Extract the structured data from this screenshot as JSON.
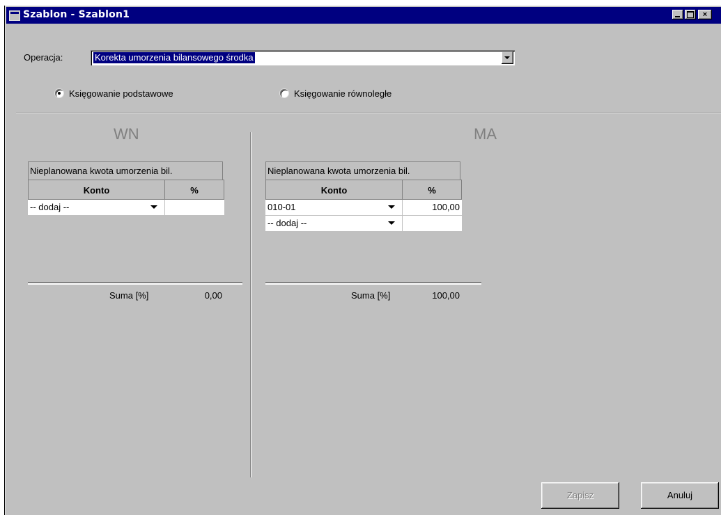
{
  "window": {
    "title": "Szablon - Szablon1",
    "min_label": "",
    "max_label": "",
    "close_label": "×"
  },
  "operation": {
    "label": "Operacja:",
    "value": "Korekta umorzenia bilansowego środka"
  },
  "posting": {
    "basic_label": "Księgowanie podstawowe",
    "parallel_label": "Księgowanie równoległe",
    "selected": "basic"
  },
  "wn": {
    "heading": "WN",
    "caption": "Nieplanowana kwota umorzenia bil.",
    "col_konto": "Konto",
    "col_pct": "%",
    "rows": [
      {
        "konto": "-- dodaj --",
        "pct": ""
      }
    ],
    "sum_label": "Suma [%]",
    "sum_value": "0,00"
  },
  "ma": {
    "heading": "MA",
    "caption": "Nieplanowana kwota umorzenia bil.",
    "col_konto": "Konto",
    "col_pct": "%",
    "rows": [
      {
        "konto": "010-01",
        "pct": "100,00"
      },
      {
        "konto": "-- dodaj --",
        "pct": ""
      }
    ],
    "sum_label": "Suma [%]",
    "sum_value": "100,00"
  },
  "buttons": {
    "save_label": "Zapisz",
    "cancel_label": "Anuluj"
  }
}
